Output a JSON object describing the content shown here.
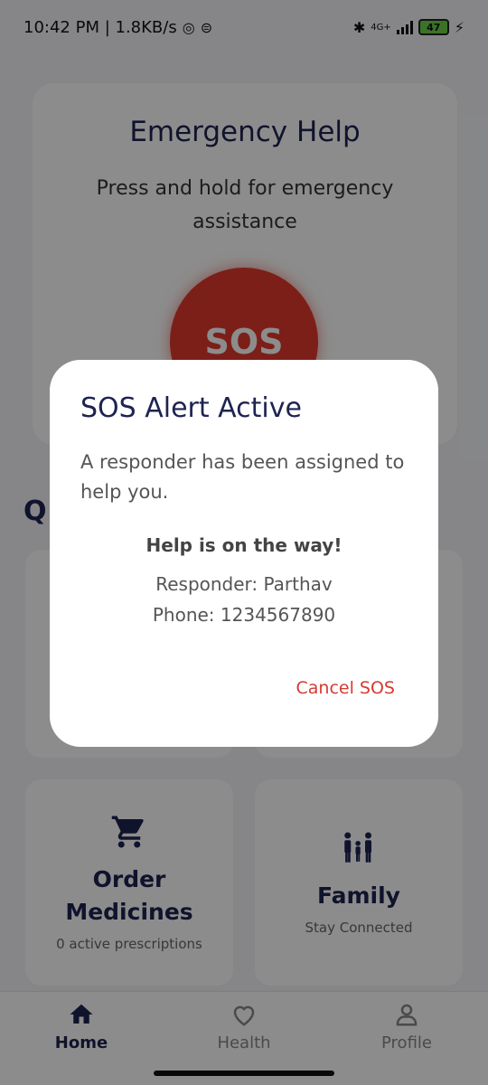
{
  "status_bar": {
    "time_speed": "10:42 PM | 1.8KB/s",
    "network": "4G+",
    "battery": "47"
  },
  "emergency": {
    "title": "Emergency Help",
    "subtitle": "Press and hold for emergency assistance",
    "sos_label": "SOS"
  },
  "quick_heading": "Q",
  "tiles": [
    {
      "title": "Order Medicines",
      "subtitle": "0 active prescriptions",
      "icon": "cart-icon"
    },
    {
      "title": "Family",
      "subtitle": "Stay Connected",
      "icon": "family-icon"
    }
  ],
  "nav": {
    "items": [
      {
        "label": "Home",
        "icon": "home-icon",
        "active": true
      },
      {
        "label": "Health",
        "icon": "heart-icon",
        "active": false
      },
      {
        "label": "Profile",
        "icon": "profile-icon",
        "active": false
      }
    ]
  },
  "dialog": {
    "title": "SOS Alert Active",
    "message": "A responder has been assigned to help you.",
    "status": "Help is on the way!",
    "responder": "Responder: Parthav",
    "phone": "Phone: 1234567890",
    "cancel_label": "Cancel SOS"
  },
  "colors": {
    "primary": "#1e2350",
    "sos_red": "#e2392d",
    "cancel_red": "#d63a32"
  }
}
